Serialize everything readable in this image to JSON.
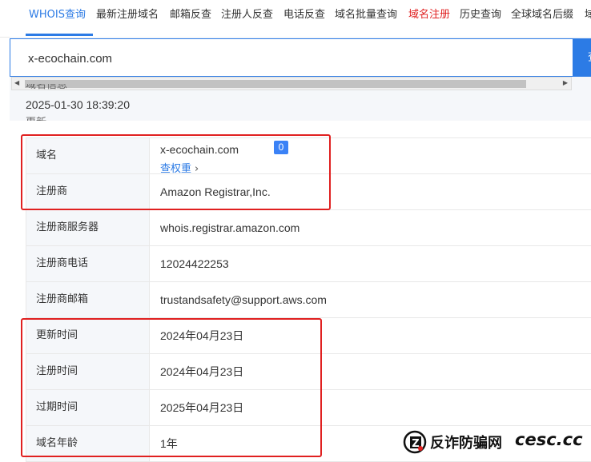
{
  "nav": {
    "tabs": [
      {
        "label": "WHOIS查询",
        "active": true
      },
      {
        "label": "最新注册域名"
      },
      {
        "label": "邮箱反查"
      },
      {
        "label": "注册人反查"
      },
      {
        "label": "电话反查"
      },
      {
        "label": "域名批量查询"
      },
      {
        "label": "域名注册",
        "highlight": "#e02020"
      },
      {
        "label": "历史查询"
      },
      {
        "label": "全球域名后缀"
      },
      {
        "label": "域"
      }
    ]
  },
  "search": {
    "value": "x-ecochain.com",
    "button_label": "查"
  },
  "info": {
    "section_label": "域名信息",
    "update_time": "2025-01-30 18:39:20",
    "refresh_label": "更新"
  },
  "table": {
    "rows": [
      {
        "label": "域名",
        "value": "x-ecochain.com",
        "badge": "0",
        "link": "查权重"
      },
      {
        "label": "注册商",
        "value": "Amazon Registrar,Inc."
      },
      {
        "label": "注册商服务器",
        "value": "whois.registrar.amazon.com"
      },
      {
        "label": "注册商电话",
        "value": "12024422253"
      },
      {
        "label": "注册商邮箱",
        "value": "trustandsafety@support.aws.com"
      },
      {
        "label": "更新时间",
        "value": "2024年04月23日"
      },
      {
        "label": "注册时间",
        "value": "2024年04月23日"
      },
      {
        "label": "过期时间",
        "value": "2025年04月23日"
      },
      {
        "label": "域名年龄",
        "value": "1年"
      }
    ]
  },
  "watermark": {
    "text_cn": "反诈防骗网",
    "text_en": "cesc.cc",
    "logo_letter": "Z"
  },
  "colors": {
    "accent": "#2c7be5",
    "highlight_red": "#e02020",
    "badge": "#3b82f6",
    "label_bg": "#f5f7fa"
  }
}
